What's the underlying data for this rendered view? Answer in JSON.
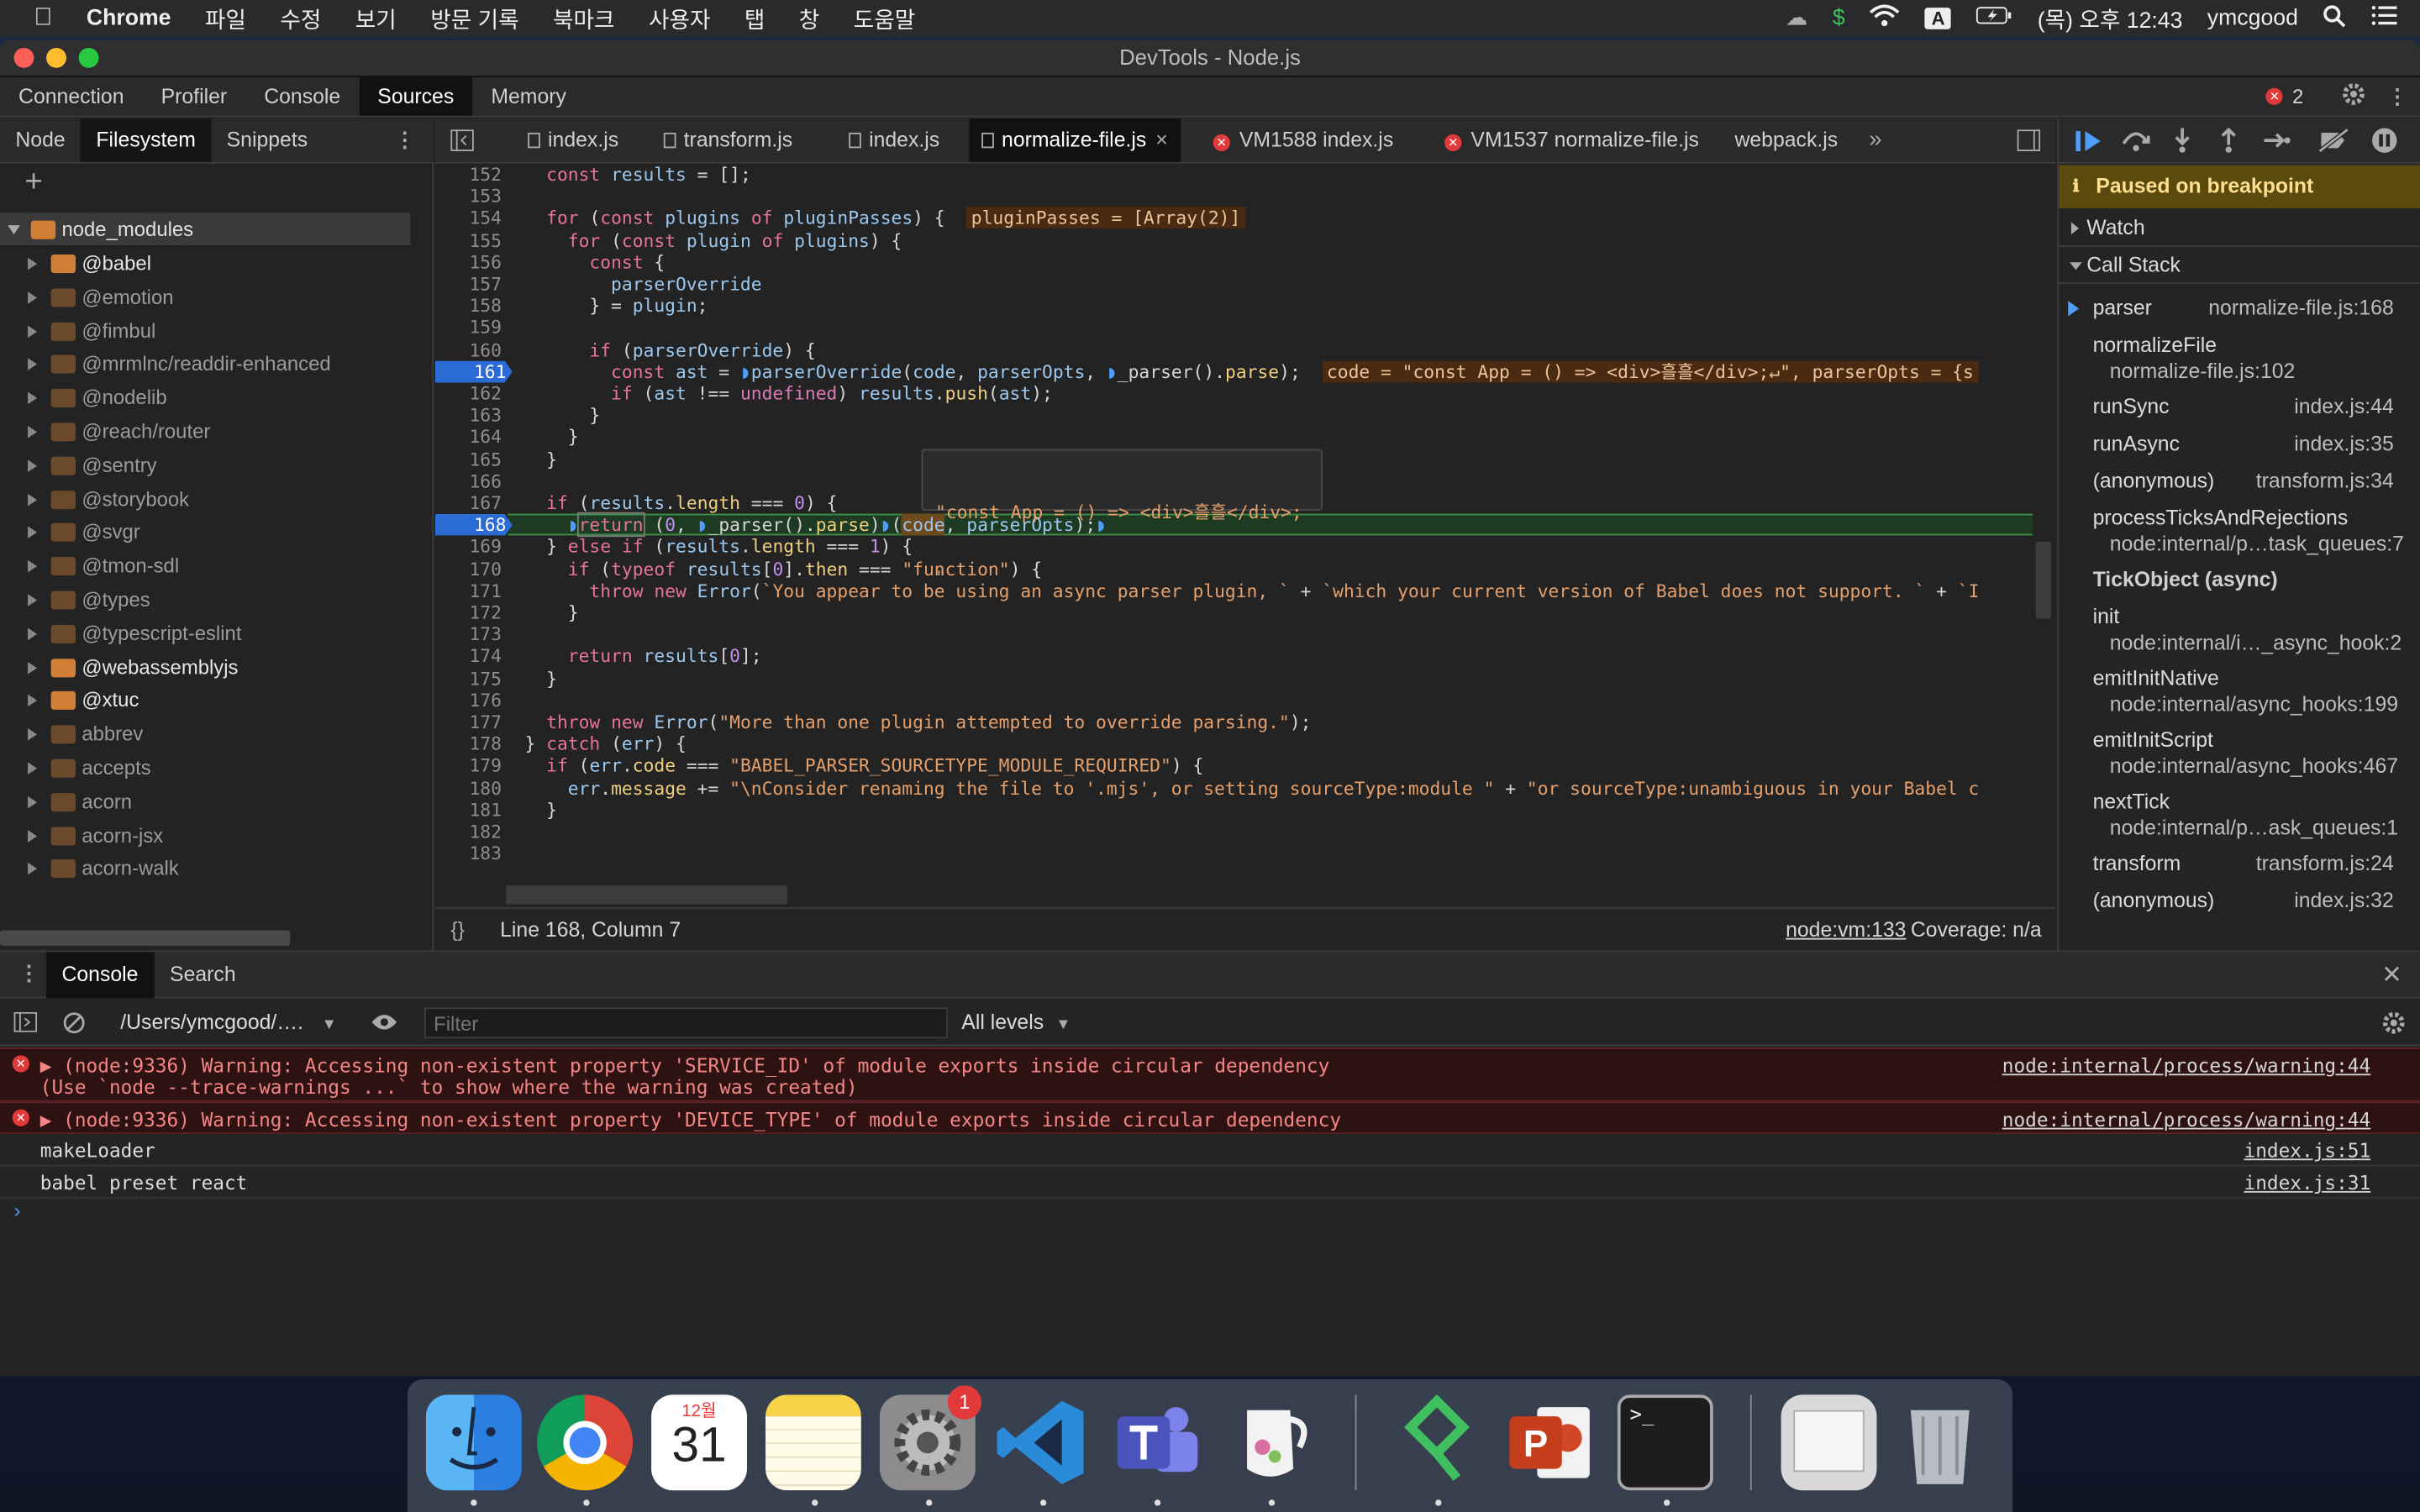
{
  "menubar": {
    "app": "Chrome",
    "items": [
      "파일",
      "수정",
      "보기",
      "방문 기록",
      "북마크",
      "사용자",
      "탭",
      "창",
      "도움말"
    ],
    "clock": "(목) 오후 12:43",
    "user": "ymcgood",
    "input_badge": "A"
  },
  "window": {
    "title": "DevTools - Node.js"
  },
  "top_tabs": [
    "Connection",
    "Profiler",
    "Console",
    "Sources",
    "Memory"
  ],
  "error_count": "2",
  "nav_tabs": [
    "Node",
    "Filesystem",
    "Snippets"
  ],
  "file_tree": {
    "root": "node_modules",
    "items": [
      {
        "name": "@babel",
        "bright": true
      },
      {
        "name": "@emotion",
        "bright": false
      },
      {
        "name": "@fimbul",
        "bright": false
      },
      {
        "name": "@mrmlnc/readdir-enhanced",
        "bright": false
      },
      {
        "name": "@nodelib",
        "bright": false
      },
      {
        "name": "@reach/router",
        "bright": false
      },
      {
        "name": "@sentry",
        "bright": false
      },
      {
        "name": "@storybook",
        "bright": false
      },
      {
        "name": "@svgr",
        "bright": false
      },
      {
        "name": "@tmon-sdl",
        "bright": false
      },
      {
        "name": "@types",
        "bright": false
      },
      {
        "name": "@typescript-eslint",
        "bright": false
      },
      {
        "name": "@webassemblyjs",
        "bright": true
      },
      {
        "name": "@xtuc",
        "bright": true
      },
      {
        "name": "abbrev",
        "bright": false
      },
      {
        "name": "accepts",
        "bright": false
      },
      {
        "name": "acorn",
        "bright": false
      },
      {
        "name": "acorn-jsx",
        "bright": false
      },
      {
        "name": "acorn-walk",
        "bright": false
      }
    ]
  },
  "editor_tabs": [
    {
      "label": "index.js",
      "type": "file"
    },
    {
      "label": "transform.js",
      "type": "file"
    },
    {
      "label": "index.js",
      "type": "file"
    },
    {
      "label": "normalize-file.js",
      "type": "active"
    },
    {
      "label": "VM1588 index.js",
      "type": "error"
    },
    {
      "label": "VM1537 normalize-file.js",
      "type": "error"
    },
    {
      "label": "webpack.js",
      "type": "plain"
    }
  ],
  "code_lines": [
    {
      "n": "152",
      "html": "  <span class=\"kw\">const</span> <span class=\"var\">results</span> = [];"
    },
    {
      "n": "153",
      "html": ""
    },
    {
      "n": "154",
      "html": "  <span class=\"kw\">for</span> (<span class=\"kw\">const</span> <span class=\"var\">plugins</span> <span class=\"kw\">of</span> <span class=\"var\">pluginPasses</span>) {  <span style=\"background:#4a2a10;color:#efc39a;padding:0 3px\">pluginPasses = [Array(2)]</span>"
    },
    {
      "n": "155",
      "html": "    <span class=\"kw\">for</span> (<span class=\"kw\">const</span> <span class=\"var\">plugin</span> <span class=\"kw\">of</span> <span class=\"var\">plugins</span>) {"
    },
    {
      "n": "156",
      "html": "      <span class=\"kw\">const</span> {"
    },
    {
      "n": "157",
      "html": "        <span class=\"var\">parserOverride</span>"
    },
    {
      "n": "158",
      "html": "      } = <span class=\"var\">plugin</span>;"
    },
    {
      "n": "159",
      "html": ""
    },
    {
      "n": "160",
      "html": "      <span class=\"kw\">if</span> (<span class=\"var\">parserOverride</span>) {"
    },
    {
      "n": "161",
      "html": "        <span class=\"kw\">const</span> <span class=\"var\">ast</span> = <span style=\"color:#4f9dfd\">◗</span><span class=\"var\">parserOverride</span>(<span class=\"var\">code</span>, <span class=\"var\">parserOpts</span>, <span style=\"color:#4f9dfd\">◗</span>_parser().<span class=\"prop\">parse</span>);  <span style=\"background:#4a2a10;color:#efc39a;padding:0 3px\">code = \"const App = () =&gt; &lt;div&gt;흘흘&lt;/div&gt;;↵\", parserOpts = {s</span>",
      "bp": true
    },
    {
      "n": "162",
      "html": "        <span class=\"kw\">if</span> (<span class=\"var\">ast</span> !== <span class=\"kw2\">undefined</span>) <span class=\"var\">results</span>.<span class=\"prop\">push</span>(<span class=\"var\">ast</span>);"
    },
    {
      "n": "163",
      "html": "      }"
    },
    {
      "n": "164",
      "html": "    }"
    },
    {
      "n": "165",
      "html": "  }"
    },
    {
      "n": "166",
      "html": ""
    },
    {
      "n": "167",
      "html": "  <span class=\"kw\">if</span> (<span class=\"var\">results</span>.<span class=\"prop\">length</span> === <span class=\"num\">0</span>) {"
    },
    {
      "n": "168",
      "html": "    <span style=\"color:#4f9dfd\">◗</span><span class=\"kw\" style=\"outline:1px solid #7a7a7a\">return</span> (<span class=\"num\">0</span>, <span style=\"color:#4f9dfd\">◗</span>_parser().<span class=\"prop\">parse</span>)<span style=\"color:#4f9dfd\">◗</span>(<span class=\"var\" style=\"background:#6e4a1c\">code</span>, <span class=\"var\">parserOpts</span>);<span style=\"color:#4f9dfd\">◗</span>",
      "bp": true,
      "current": true
    },
    {
      "n": "169",
      "html": "  } <span class=\"kw\">else</span> <span class=\"kw\">if</span> (<span class=\"var\">results</span>.<span class=\"prop\">length</span> === <span class=\"num\">1</span>) {"
    },
    {
      "n": "170",
      "html": "    <span class=\"kw\">if</span> (<span class=\"kw\">typeof</span> <span class=\"var\">results</span>[<span class=\"num\">0</span>].<span class=\"prop\">then</span> === <span class=\"str\">\"function\"</span>) {"
    },
    {
      "n": "171",
      "html": "      <span class=\"kw\">throw</span> <span class=\"kw\">new</span> <span class=\"var\">Error</span>(<span class=\"str\">`You appear to be using an async parser plugin, `</span> + <span class=\"str\">`which your current version of Babel does not support. `</span> + <span class=\"str\">`I</span>"
    },
    {
      "n": "172",
      "html": "    }"
    },
    {
      "n": "173",
      "html": ""
    },
    {
      "n": "174",
      "html": "    <span class=\"kw\">return</span> <span class=\"var\">results</span>[<span class=\"num\">0</span>];"
    },
    {
      "n": "175",
      "html": "  }"
    },
    {
      "n": "176",
      "html": ""
    },
    {
      "n": "177",
      "html": "  <span class=\"kw\">throw</span> <span class=\"kw\">new</span> <span class=\"var\">Error</span>(<span class=\"str\">\"More than one plugin attempted to override parsing.\"</span>);"
    },
    {
      "n": "178",
      "html": "} <span class=\"kw\">catch</span> (<span class=\"var\">err</span>) {"
    },
    {
      "n": "179",
      "html": "  <span class=\"kw\">if</span> (<span class=\"var\">err</span>.<span class=\"prop\">code</span> === <span class=\"str\">\"BABEL_PARSER_SOURCETYPE_MODULE_REQUIRED\"</span>) {"
    },
    {
      "n": "180",
      "html": "    <span class=\"var\">err</span>.<span class=\"prop\">message</span> += <span class=\"str\">\"\\nConsider renaming the file to '.mjs', or setting sourceType:module \"</span> + <span class=\"str\">\"or sourceType:unambiguous in your Babel c</span>"
    },
    {
      "n": "181",
      "html": "  }"
    },
    {
      "n": "182",
      "html": ""
    },
    {
      "n": "183",
      "html": ""
    }
  ],
  "tooltip": {
    "line1": "\"const App = () => <div>흘흘</div>;",
    "line2": "\""
  },
  "status": {
    "position": "Line 168, Column 7",
    "source": "node:vm:133",
    "coverage": "Coverage: n/a"
  },
  "debugger": {
    "paused": "Paused on breakpoint",
    "watch": "Watch",
    "call_stack": "Call Stack",
    "frames": [
      {
        "name": "parser",
        "loc": "normalize-file.js:168",
        "inline": true,
        "current": true
      },
      {
        "name": "normalizeFile",
        "loc": "normalize-file.js:102",
        "inline": false
      },
      {
        "name": "runSync",
        "loc": "index.js:44",
        "inline": true
      },
      {
        "name": "runAsync",
        "loc": "index.js:35",
        "inline": true
      },
      {
        "name": "(anonymous)",
        "loc": "transform.js:34",
        "inline": true
      },
      {
        "name": "processTicksAndRejections",
        "loc": "node:internal/p…task_queues:7",
        "inline": false
      },
      {
        "name": "TickObject (async)",
        "loc": "",
        "header": true
      },
      {
        "name": "init",
        "loc": "node:internal/i…_async_hook:2",
        "inline": false
      },
      {
        "name": "emitInitNative",
        "loc": "node:internal/async_hooks:199",
        "inline": false
      },
      {
        "name": "emitInitScript",
        "loc": "node:internal/async_hooks:467",
        "inline": false
      },
      {
        "name": "nextTick",
        "loc": "node:internal/p…ask_queues:1",
        "inline": false
      },
      {
        "name": "transform",
        "loc": "transform.js:24",
        "inline": true
      },
      {
        "name": "(anonymous)",
        "loc": "index.js:32",
        "inline": true
      }
    ]
  },
  "drawer": {
    "tabs": [
      "Console",
      "Search"
    ],
    "context": "/Users/ymcgood/….",
    "filter_placeholder": "Filter",
    "levels": "All levels"
  },
  "console_messages": [
    {
      "text": "▶ (node:9336) Warning: Accessing non-existent property 'SERVICE_ID' of module exports inside circular dependency",
      "text2": "(Use `node --trace-warnings ...` to show where the warning was created)",
      "link": "node:internal/process/warning:44",
      "error": true
    },
    {
      "text": "▶ (node:9336) Warning: Accessing non-existent property 'DEVICE_TYPE' of module exports inside circular dependency",
      "text2": "",
      "link": "node:internal/process/warning:44",
      "error": true
    },
    {
      "text": "makeLoader",
      "text2": "",
      "link": "index.js:51",
      "error": false
    },
    {
      "text": "babel preset react",
      "text2": "",
      "link": "index.js:31",
      "error": false
    }
  ],
  "dock": {
    "apps": [
      "Finder",
      "Chrome",
      "Calendar",
      "Notes",
      "System Preferences",
      "VS Code",
      "Teams",
      "Creamer",
      "Git app",
      "PowerPoint",
      "Terminal",
      "Documents",
      "Trash"
    ],
    "calendar_month": "12월",
    "calendar_day": "31",
    "prefs_badge": "1"
  },
  "colors": {
    "accent": "#2a6bd6",
    "paused_bg": "#5b4a0e",
    "error_bg": "#2e1212",
    "folder": "#d27f36"
  }
}
